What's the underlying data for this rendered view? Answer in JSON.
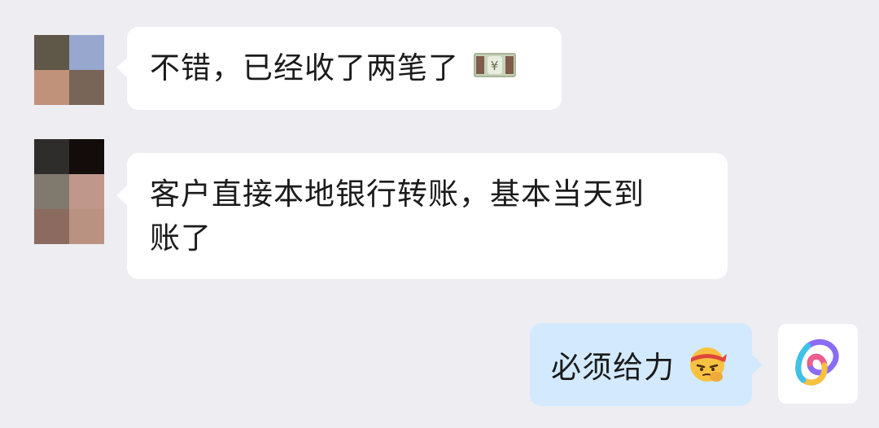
{
  "messages": [
    {
      "direction": "incoming",
      "text": "不错，已经收了两笔了",
      "trailing_icon": "yen-banknote-emoji",
      "avatar_colors": [
        "#5f5748",
        "#97a7cd",
        "#c1927a",
        "#786557"
      ]
    },
    {
      "direction": "incoming",
      "text_line1": "客户直接本地银行转账，基本当天到",
      "text_line2": "账了",
      "avatar_colors": [
        "#2f2d2c",
        "#120d0a",
        "#7f7a6d",
        "#c0978b",
        "#8b6a5f",
        "#ba9282"
      ]
    },
    {
      "direction": "outgoing",
      "text": "必须给力",
      "trailing_icon": "headband-determined-emoji"
    }
  ],
  "self_avatar": {
    "icon": "colorful-loop-logo-icon"
  }
}
